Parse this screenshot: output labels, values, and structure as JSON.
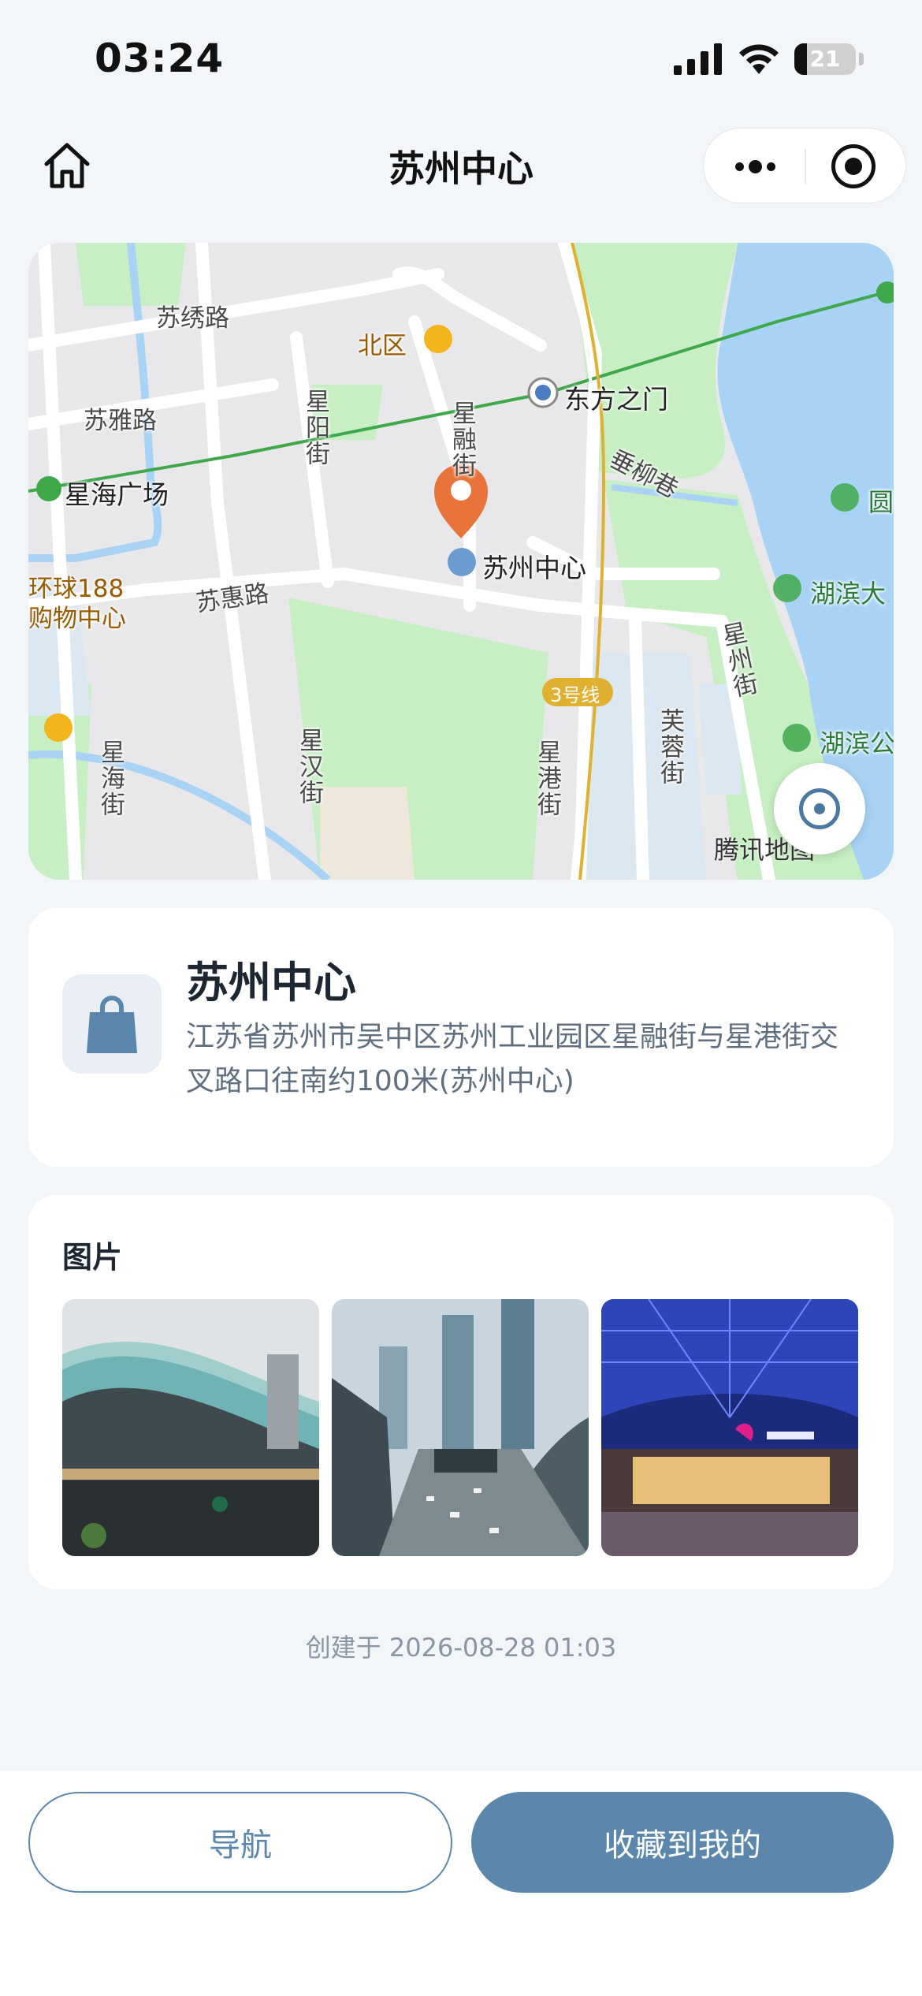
{
  "status_bar": {
    "time": "03:24",
    "battery": "21",
    "battery_level": 0.21
  },
  "nav": {
    "title": "苏州中心"
  },
  "map": {
    "labels": {
      "suxiu_road": "苏绣路",
      "suya_road": "苏雅路",
      "beiqu": "北区",
      "dongfang_gate": "东方之门",
      "xingyang_street": "星阳街",
      "xingrong_street": "星融街",
      "chuiliu_lane": "垂柳巷",
      "xinghai_square": "星海广场",
      "suzhou_center": "苏州中心",
      "yuan": "圆",
      "huanqiu_188": "环球188\n购物中心",
      "suhui_road": "苏惠路",
      "hubin_1": "湖滨大",
      "xingzhou_street": "星州街",
      "line3": "3号线",
      "furong_street": "芙蓉街",
      "hubin_2": "湖滨公",
      "xinghai_street": "星海街",
      "xinghan_street": "星汉街",
      "xinggang_street": "星港街",
      "map_logo": "腾讯地图"
    }
  },
  "place": {
    "name": "苏州中心",
    "address": "江苏省苏州市吴中区苏州工业园区星融街与星港街交叉路口往南约100米(苏州中心)"
  },
  "photos": {
    "title": "图片",
    "items": [
      {
        "alt": "苏州中心 glass roof building"
      },
      {
        "alt": "苏州中心 towers street view"
      },
      {
        "alt": "苏州中心 night atrium"
      }
    ]
  },
  "created_at": "创建于 2026-08-28 01:03",
  "actions": {
    "navigate": "导航",
    "favorite": "收藏到我的"
  },
  "colors": {
    "accent": "#5b87ad",
    "pin": "#e8743b",
    "park": "#c7efc3",
    "water": "#a8d3f5"
  }
}
